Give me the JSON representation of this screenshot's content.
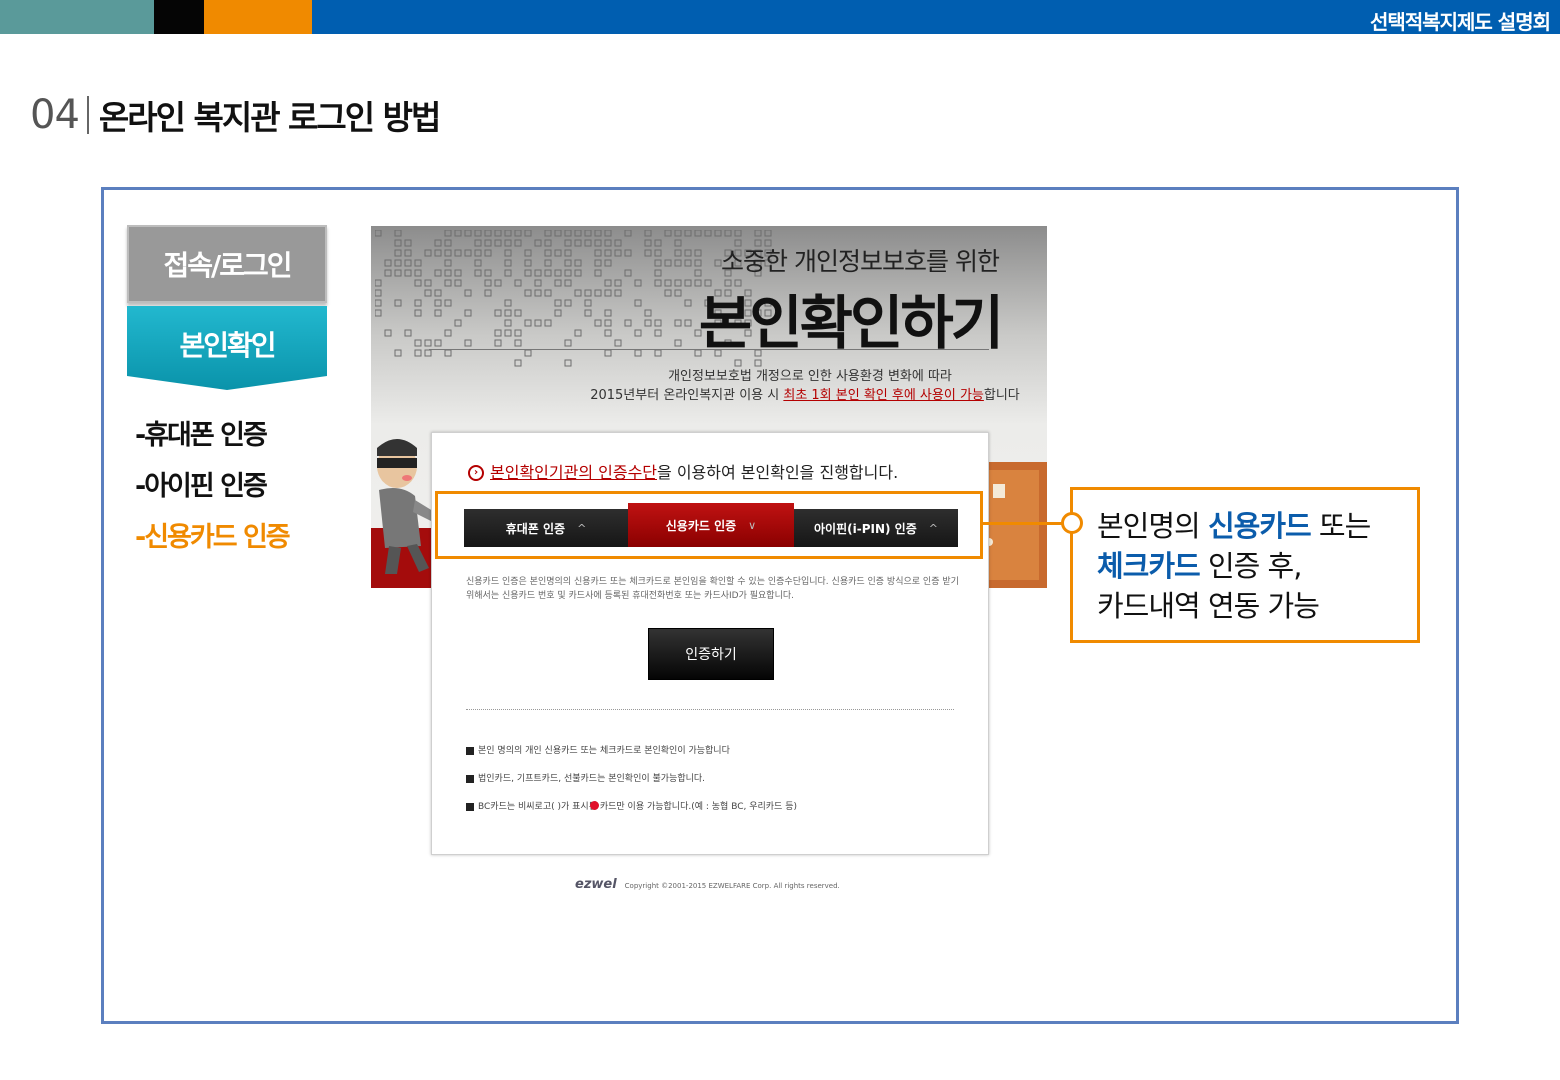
{
  "header": {
    "title": "선택적복지제도 설명회"
  },
  "heading": {
    "number": "04",
    "title": "온라인 복지관 로그인 방법"
  },
  "steps": [
    {
      "label": "접속/로그인"
    },
    {
      "label": "본인확인"
    }
  ],
  "methods": [
    {
      "label": "-휴대폰 인증",
      "active": false
    },
    {
      "label": "-아이핀 인증",
      "active": false
    },
    {
      "label": "-신용카드 인증",
      "active": true
    }
  ],
  "screen": {
    "subtitle": "소중한 개인정보보호를 위한",
    "title": "본인확인하기",
    "info_line1": "개인정보보호법 개정으로 인한 사용환경 변화에 따라",
    "info_line2_prefix": "2015년부터 온라인복지관 이용 시 ",
    "info_line2_highlight": "최초 1회 본인 확인 후에 사용이 가능",
    "info_line2_suffix": "합니다",
    "panel_head_highlight": "본인확인기관의 인증수단",
    "panel_head_rest": "을 이용하여 본인확인을 진행합니다.",
    "tabs": [
      {
        "label": "휴대폰 인증",
        "chevron": "^"
      },
      {
        "label": "신용카드 인증",
        "chevron": "∨"
      },
      {
        "label": "아이핀(i-PIN) 인증",
        "chevron": "^"
      }
    ],
    "description": "신용카드 인증은 본인명의의 신용카드 또는 체크카드로 본인임을 확인할 수 있는 인증수단입니다. 신용카드 인증 방식으로 인증 받기 위해서는 신용카드 번호 및 카드사에 등록된 휴대전화번호 또는 카드사ID가 필요합니다.",
    "auth_button": "인증하기",
    "notes": [
      "본인 명의의 개인 신용카드 또는 체크카드로 본인확인이 가능합니다",
      "법인카드, 기프트카드, 선불카드는 본인확인이 불가능합니다.",
      "BC카드는 비씨로고(     )가 표시된 카드만 이용 가능합니다.(예 : 농협 BC, 우리카드 등)"
    ],
    "footer_logo": "ezwel",
    "footer_text": "Copyright ©2001-2015 EZWELFARE Corp. All rights reserved."
  },
  "callout": {
    "line1_a": "본인명의 ",
    "line1_b": "신용카드",
    "line1_c": " 또는",
    "line2_a": "체크카드",
    "line2_b": " 인증 후,",
    "line3": "카드내역 연동 가능"
  },
  "colors": {
    "accent": "#f08a00",
    "blue": "#005eb0",
    "teal": "#1aa6bf",
    "red": "#b40000"
  }
}
